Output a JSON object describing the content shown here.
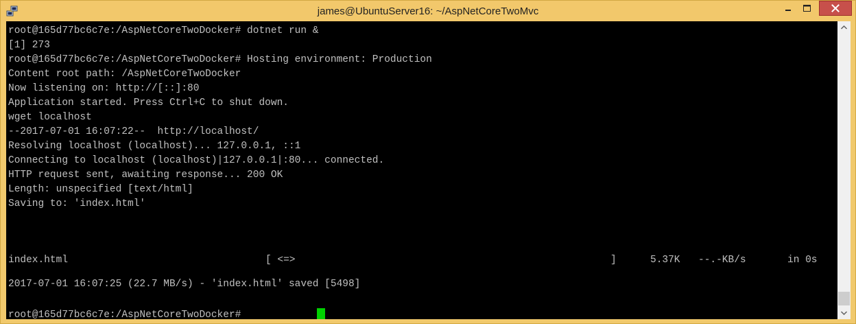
{
  "window": {
    "title": "james@UbuntuServer16: ~/AspNetCoreTwoMvc",
    "icon": "putty-icon",
    "controls": {
      "minimize": "minimize-icon",
      "maximize": "maximize-icon",
      "close": "close-icon"
    }
  },
  "terminal": {
    "lines": [
      "root@165d77bc6c7e:/AspNetCoreTwoDocker# dotnet run &",
      "[1] 273",
      "root@165d77bc6c7e:/AspNetCoreTwoDocker# Hosting environment: Production",
      "Content root path: /AspNetCoreTwoDocker",
      "Now listening on: http://[::]:80",
      "Application started. Press Ctrl+C to shut down.",
      "wget localhost",
      "--2017-07-01 16:07:22--  http://localhost/",
      "Resolving localhost (localhost)... 127.0.0.1, ::1",
      "Connecting to localhost (localhost)|127.0.0.1|:80... connected.",
      "HTTP request sent, awaiting response... 200 OK",
      "Length: unspecified [text/html]",
      "Saving to: 'index.html'",
      "",
      "",
      "",
      "2017-07-01 16:07:25 (22.7 MB/s) - 'index.html' saved [5498]",
      "",
      "root@165d77bc6c7e:/AspNetCoreTwoDocker# "
    ],
    "progress": {
      "filename": "index.html",
      "bar": "[ <=>",
      "bar_end": "]",
      "size": "5.37K",
      "speed": "--.-KB/s",
      "eta": "in 0s"
    }
  },
  "colors": {
    "titlebar": "#f2c86b",
    "background": "#000000",
    "text": "#c0c0c0",
    "cursor": "#00d200",
    "close_button": "#c7504b"
  }
}
